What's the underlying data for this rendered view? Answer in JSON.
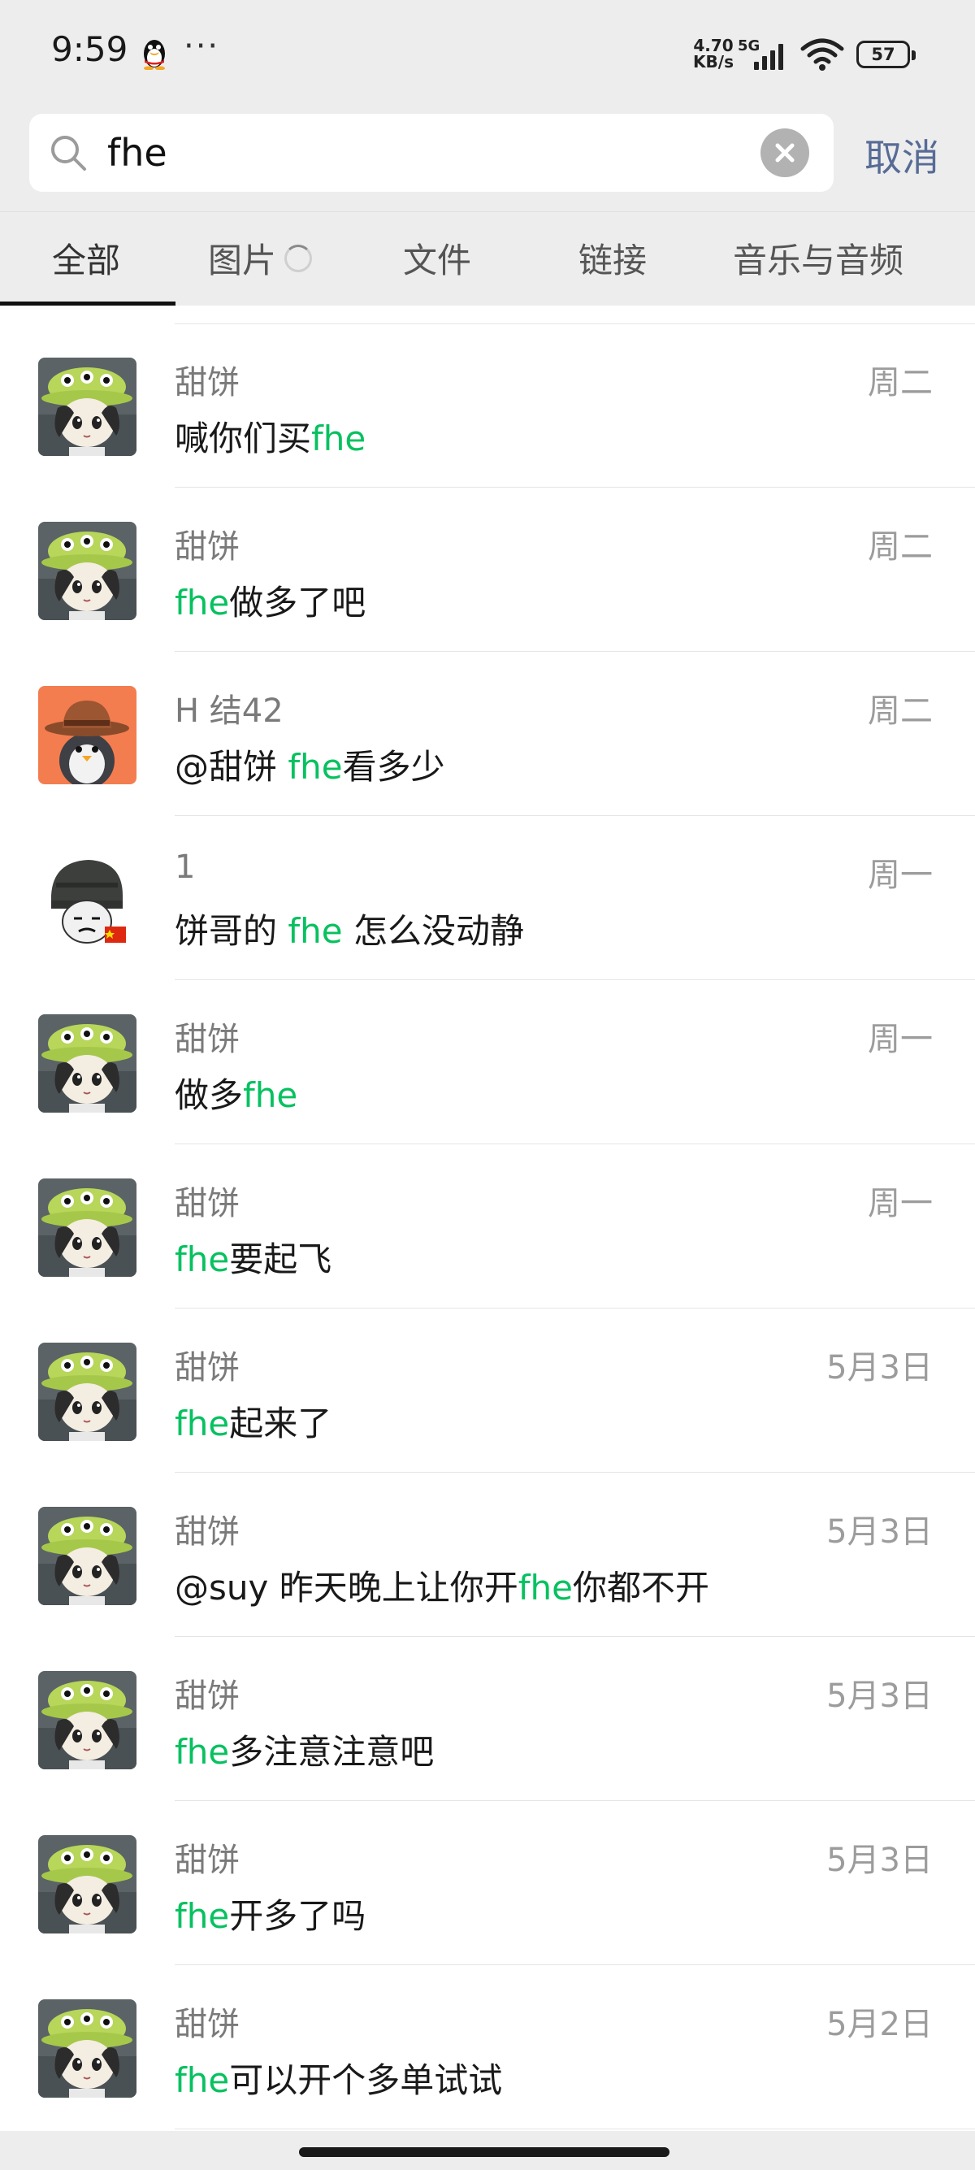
{
  "status_bar": {
    "time": "9:59",
    "more": "···",
    "net_speed_value": "4.70",
    "net_speed_unit": "KB/s",
    "network_type": "5G",
    "battery": "57",
    "icons": [
      "qq-penguin-icon",
      "signal-icon",
      "wifi-icon",
      "battery-icon"
    ]
  },
  "search": {
    "value": "fhe",
    "cancel_label": "取消"
  },
  "tabs": [
    {
      "label": "全部",
      "active": true
    },
    {
      "label": "图片",
      "active": false,
      "loading": true
    },
    {
      "label": "文件",
      "active": false
    },
    {
      "label": "链接",
      "active": false
    },
    {
      "label": "音乐与音频",
      "active": false
    }
  ],
  "results": [
    {
      "sender": "甜饼",
      "date": "周二",
      "avatar": "alien-hat-girl",
      "message": [
        {
          "t": "喊你们买"
        },
        {
          "t": "fhe",
          "hl": true
        }
      ]
    },
    {
      "sender": "甜饼",
      "date": "周二",
      "avatar": "alien-hat-girl",
      "message": [
        {
          "t": "fhe",
          "hl": true
        },
        {
          "t": "做多了吧"
        }
      ]
    },
    {
      "sender": "H 结42",
      "date": "周二",
      "avatar": "penguin-cowboy",
      "message": [
        {
          "t": "@甜饼 "
        },
        {
          "t": "fhe",
          "hl": true
        },
        {
          "t": "看多少"
        }
      ]
    },
    {
      "sender": "1",
      "date": "周一",
      "avatar": "helmet-meme",
      "message": [
        {
          "t": "饼哥的 "
        },
        {
          "t": "fhe",
          "hl": true
        },
        {
          "t": " 怎么没动静"
        }
      ]
    },
    {
      "sender": "甜饼",
      "date": "周一",
      "avatar": "alien-hat-girl",
      "message": [
        {
          "t": "做多"
        },
        {
          "t": "fhe",
          "hl": true
        }
      ]
    },
    {
      "sender": "甜饼",
      "date": "周一",
      "avatar": "alien-hat-girl",
      "message": [
        {
          "t": "fhe",
          "hl": true
        },
        {
          "t": "要起飞"
        }
      ]
    },
    {
      "sender": "甜饼",
      "date": "5月3日",
      "avatar": "alien-hat-girl",
      "message": [
        {
          "t": "fhe",
          "hl": true
        },
        {
          "t": "起来了"
        }
      ]
    },
    {
      "sender": "甜饼",
      "date": "5月3日",
      "avatar": "alien-hat-girl",
      "message": [
        {
          "t": "@suy 昨天晚上让你开"
        },
        {
          "t": "fhe",
          "hl": true
        },
        {
          "t": "你都不开"
        }
      ]
    },
    {
      "sender": "甜饼",
      "date": "5月3日",
      "avatar": "alien-hat-girl",
      "message": [
        {
          "t": "fhe",
          "hl": true
        },
        {
          "t": "多注意注意吧"
        }
      ]
    },
    {
      "sender": "甜饼",
      "date": "5月3日",
      "avatar": "alien-hat-girl",
      "message": [
        {
          "t": "fhe",
          "hl": true
        },
        {
          "t": "开多了吗"
        }
      ]
    },
    {
      "sender": "甜饼",
      "date": "5月2日",
      "avatar": "alien-hat-girl",
      "message": [
        {
          "t": "fhe",
          "hl": true
        },
        {
          "t": "可以开个多单试试"
        }
      ]
    }
  ],
  "colors": {
    "highlight": "#07c160",
    "cancel": "#576b95",
    "background": "#ededed"
  }
}
